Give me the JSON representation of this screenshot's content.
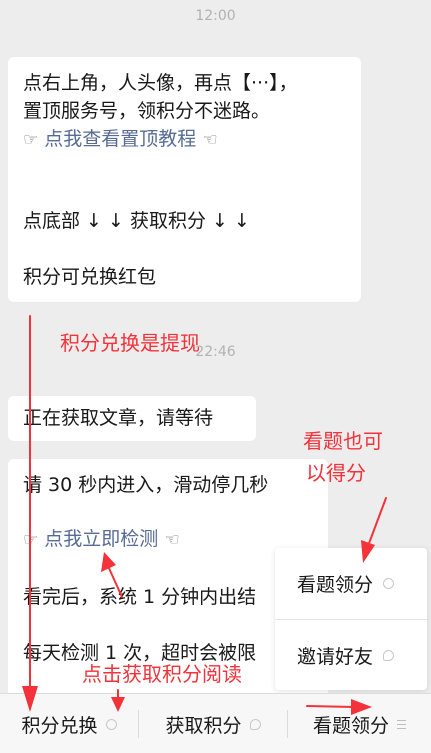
{
  "chat": {
    "time_top": "12:00",
    "time_mid": "22:46",
    "msg1": {
      "line1": "点右上角，人头像，再点【···】，",
      "line2": "置顶服务号，领积分不迷路。",
      "link_hand_left": "☞",
      "link_text": "点我查看置顶教程",
      "link_hand_right": "☜",
      "line4": "点底部 ↓ ↓ 获取积分 ↓ ↓",
      "line5": "积分可兑换红包"
    },
    "msg2": {
      "text": "正在获取文章，请等待"
    },
    "msg3": {
      "line1": "请 30 秒内进入，滑动停几秒",
      "link_hand_left": "☞",
      "link_text": "点我立即检测",
      "link_hand_right": "☜",
      "line3": "看完后，系统 1 分钟内出结",
      "line4": "每天检测 1 次，超时会被限"
    }
  },
  "annotations": {
    "exchange_note": "积分兑换是提现",
    "view_note_line1": "看题也可",
    "view_note_line2": "以得分",
    "click_note": "点击获取积分阅读",
    "color": "#f3323a"
  },
  "popup_menu": {
    "items": [
      {
        "label": "看题领分",
        "icon": "mini-program-icon"
      },
      {
        "label": "邀请好友",
        "icon": "speech-bubble-icon"
      }
    ]
  },
  "bottom_menu": {
    "tabs": [
      {
        "label": "积分兑换",
        "icon": "mini-program-icon"
      },
      {
        "label": "获取积分",
        "icon": "speech-bubble-icon"
      },
      {
        "label": "看题领分",
        "icon": "menu-lines-icon"
      }
    ]
  }
}
